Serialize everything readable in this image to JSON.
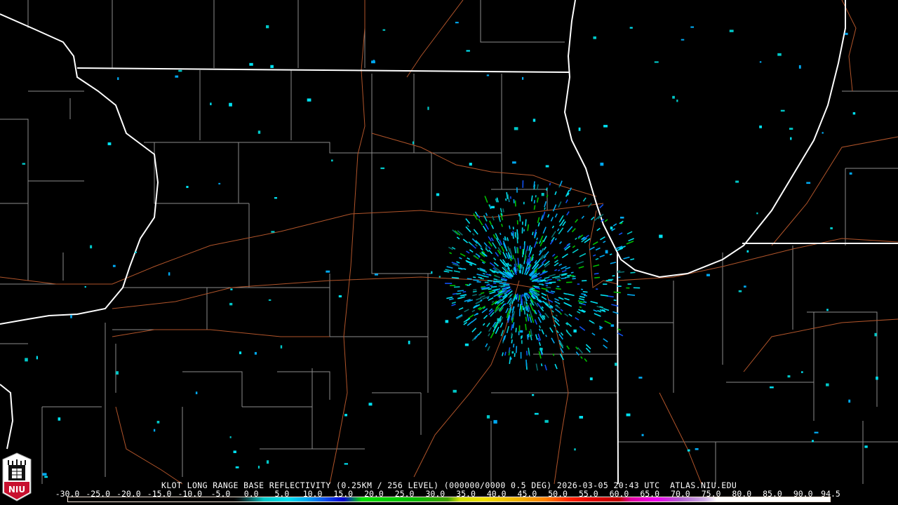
{
  "product": {
    "title": "KLOT LONG RANGE BASE REFLECTIVITY (0.25KM / 256 LEVEL) (000000/0000 0.5 DEG) 2026-03-05 20:43 UTC  ATLAS.NIU.EDU",
    "radar": "KLOT",
    "timestamp": "2026-03-05 20:43 UTC",
    "source": "ATLAS.NIU.EDU"
  },
  "logo": {
    "text": "NIU",
    "accent": "#c8102e"
  },
  "colorbar": {
    "labels": [
      "-30.0",
      "-25.0",
      "-20.0",
      "-15.0",
      "-10.0",
      "-5.0",
      "0.0",
      "5.0",
      "10.0",
      "15.0",
      "20.0",
      "25.0",
      "30.0",
      "35.0",
      "40.0",
      "45.0",
      "50.0",
      "55.0",
      "60.0",
      "65.0",
      "70.0",
      "75.0",
      "80.0",
      "85.0",
      "90.0",
      "94.5"
    ],
    "min": -30.0,
    "max": 94.5,
    "stops": [
      {
        "v": -30,
        "c": "#000000"
      },
      {
        "v": -3,
        "c": "#000000"
      },
      {
        "v": -2,
        "c": "#0a1a1a"
      },
      {
        "v": 0,
        "c": "#0a6b6b"
      },
      {
        "v": 2,
        "c": "#00c8c8"
      },
      {
        "v": 6,
        "c": "#00e0f0"
      },
      {
        "v": 9,
        "c": "#00a8f0"
      },
      {
        "v": 12,
        "c": "#1050f0"
      },
      {
        "v": 15,
        "c": "#0000d0"
      },
      {
        "v": 16.5,
        "c": "#007070"
      },
      {
        "v": 18,
        "c": "#00e000"
      },
      {
        "v": 26,
        "c": "#00c000"
      },
      {
        "v": 32,
        "c": "#40a000"
      },
      {
        "v": 34,
        "c": "#d0e000"
      },
      {
        "v": 38,
        "c": "#f0e000"
      },
      {
        "v": 44,
        "c": "#f0b000"
      },
      {
        "v": 48,
        "c": "#ff8000"
      },
      {
        "v": 52,
        "c": "#ff2000"
      },
      {
        "v": 56,
        "c": "#e00000"
      },
      {
        "v": 60,
        "c": "#c00000"
      },
      {
        "v": 62,
        "c": "#e000a0"
      },
      {
        "v": 66,
        "c": "#f000f0"
      },
      {
        "v": 70,
        "c": "#b060d0"
      },
      {
        "v": 74,
        "c": "#d0b0e8"
      },
      {
        "v": 76,
        "c": "#ffffff"
      },
      {
        "v": 94.5,
        "c": "#ffffff"
      }
    ]
  },
  "colors": {
    "state": "#ffffff",
    "county": "#8c8c8c",
    "road": "#b0542a"
  }
}
